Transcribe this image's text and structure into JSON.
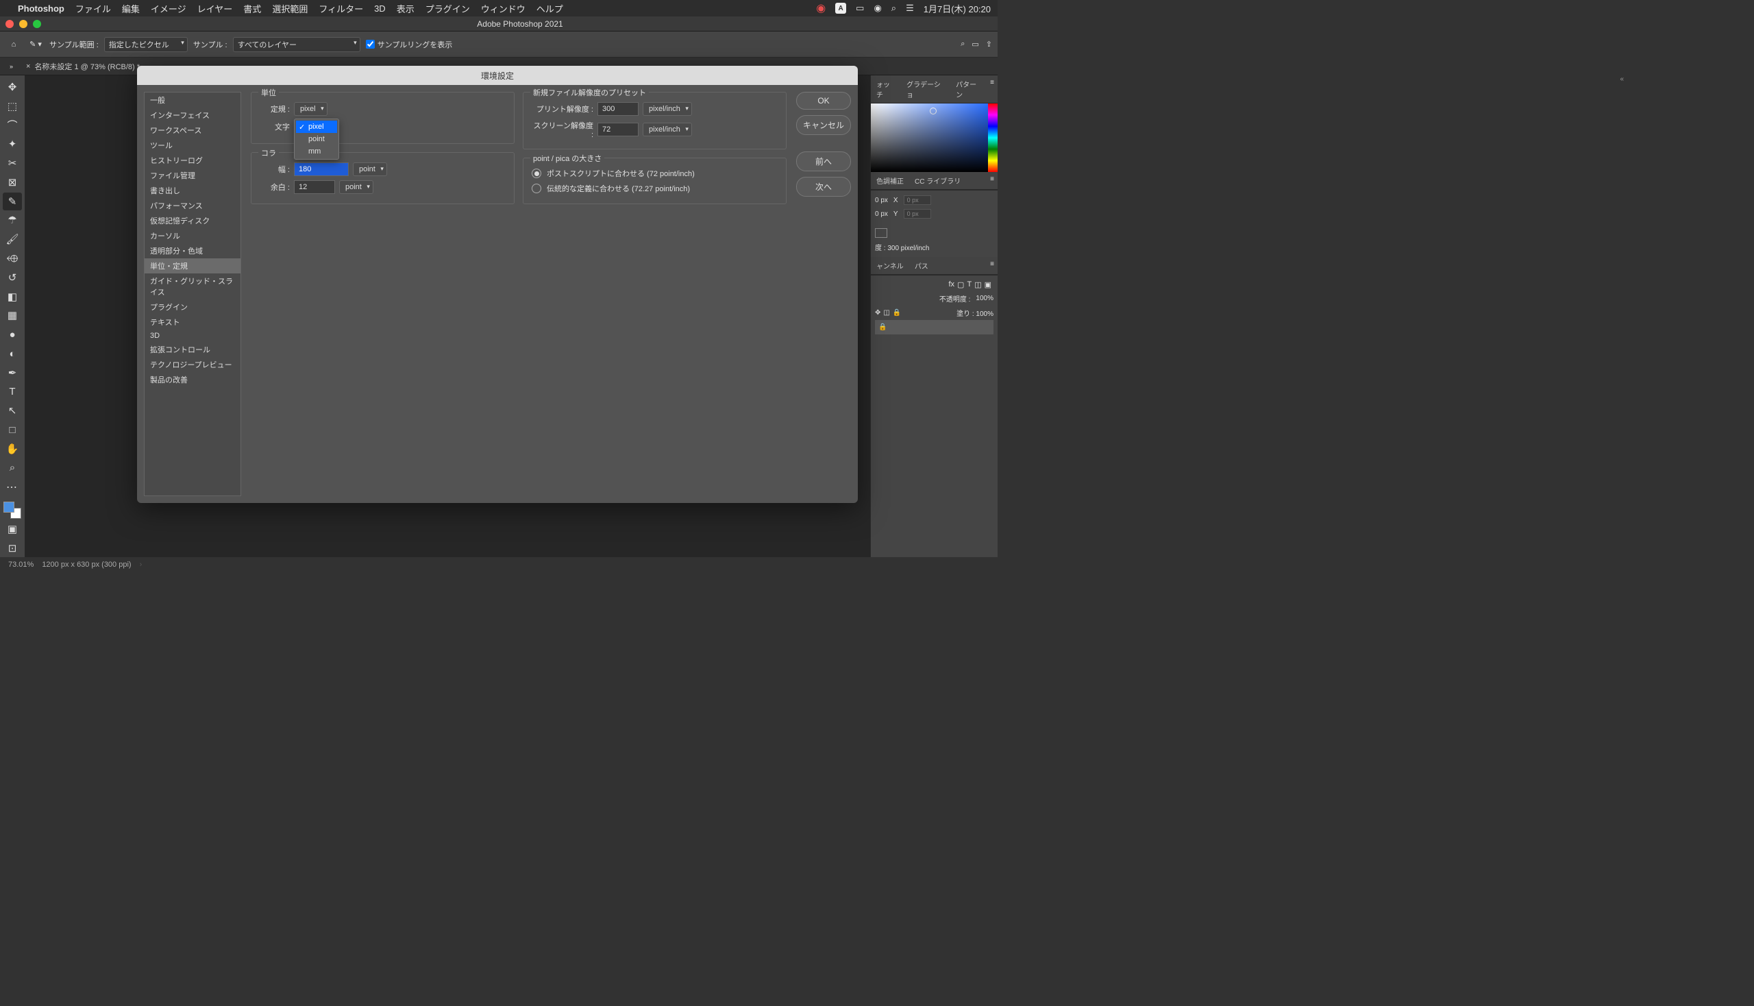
{
  "menubar": {
    "app": "Photoshop",
    "items": [
      "ファイル",
      "編集",
      "イメージ",
      "レイヤー",
      "書式",
      "選択範囲",
      "フィルター",
      "3D",
      "表示",
      "プラグイン",
      "ウィンドウ",
      "ヘルプ"
    ],
    "date": "1月7日(木)  20:20"
  },
  "window": {
    "title": "Adobe Photoshop 2021"
  },
  "options": {
    "sample_range_label": "サンプル範囲 :",
    "sample_range_value": "指定したピクセル",
    "sample_label": "サンプル :",
    "sample_value": "すべてのレイヤー",
    "show_ring": "サンプルリングを表示"
  },
  "tab": {
    "name": "名称未設定 1 @ 73% (RCB/8) *"
  },
  "dialog": {
    "title": "環境設定",
    "sidebar": [
      "一般",
      "インターフェイス",
      "ワークスペース",
      "ツール",
      "ヒストリーログ",
      "ファイル管理",
      "書き出し",
      "パフォーマンス",
      "仮想記憶ディスク",
      "カーソル",
      "透明部分・色域",
      "単位・定規",
      "ガイド・グリッド・スライス",
      "プラグイン",
      "テキスト",
      "3D",
      "拡張コントロール",
      "テクノロジープレビュー",
      "製品の改善"
    ],
    "selected_index": 11,
    "units": {
      "group": "単位",
      "ruler_label": "定規 :",
      "ruler_value": "pixel",
      "type_label": "文字",
      "dropdown": [
        "pixel",
        "point",
        "mm"
      ],
      "dropdown_selected": 0
    },
    "newdoc": {
      "group": "新規ファイル解像度のプリセット",
      "print_label": "プリント解像度 :",
      "print_value": "300",
      "print_unit": "pixel/inch",
      "screen_label": "スクリーン解像度 :",
      "screen_value": "72",
      "screen_unit": "pixel/inch"
    },
    "column": {
      "group": "コラ",
      "width_label": "幅 :",
      "width_value": "180",
      "width_unit": "point",
      "gutter_label": "余白 :",
      "gutter_value": "12",
      "gutter_unit": "point"
    },
    "pointpica": {
      "group": "point / pica の大きさ",
      "postscript": "ポストスクリプトに合わせる (72 point/inch)",
      "traditional": "伝統的な定義に合わせる (72.27 point/inch)"
    },
    "buttons": {
      "ok": "OK",
      "cancel": "キャンセル",
      "prev": "前へ",
      "next": "次へ"
    }
  },
  "panels": {
    "swatch_tab": "ォッチ",
    "gradient_tab": "グラデーショ",
    "pattern_tab": "パターン",
    "color_correct": "色調補正",
    "cc_library": "CC ライブラリ",
    "props_px1": "0 px",
    "props_px2": "0 px",
    "props_x": "X",
    "props_y": "Y",
    "props_x_val": "0 px",
    "props_y_val": "0 px",
    "resolution": "度 : 300 pixel/inch",
    "channel": "ャンネル",
    "path": "パス",
    "opacity_label": "不透明度 :",
    "opacity_val": "100%",
    "fill_label": "塗り :",
    "fill_val": "100%"
  },
  "status": {
    "zoom": "73.01%",
    "doc": "1200 px x 630 px (300 ppi)"
  }
}
